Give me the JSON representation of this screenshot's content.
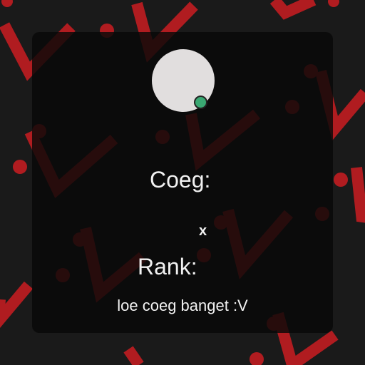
{
  "colors": {
    "background": "#1a1a1a",
    "pattern_accent": "#b01c20",
    "card": "#0b0b0b",
    "avatar": "#e1dede",
    "status_online": "#3aa872",
    "text": "#f2f2f2"
  },
  "profile": {
    "avatar_icon": "avatar-placeholder",
    "status": "online",
    "coeg_label": "Coeg:",
    "coeg_value": "x",
    "rank_label": "Rank:",
    "description": "loe coeg banget :V"
  }
}
